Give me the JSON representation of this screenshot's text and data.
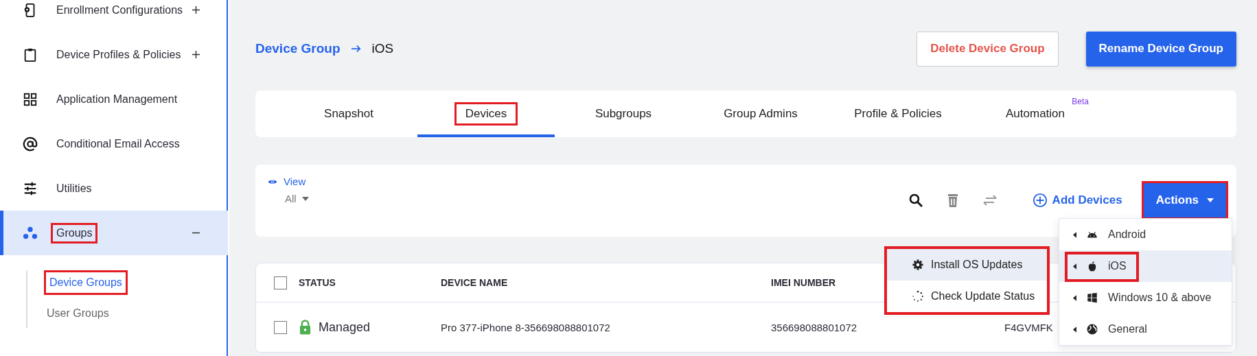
{
  "sidebar": {
    "items": [
      {
        "label": "Enrollment Configurations",
        "kind": "group",
        "expanded": false,
        "selected": false,
        "highlighted": false
      },
      {
        "label": "Device Profiles & Policies",
        "kind": "group",
        "expanded": false,
        "selected": false,
        "highlighted": false
      },
      {
        "label": "Application Management",
        "kind": "link",
        "selected": false,
        "highlighted": false
      },
      {
        "label": "Conditional Email Access",
        "kind": "link",
        "selected": false,
        "highlighted": false
      },
      {
        "label": "Utilities",
        "kind": "link",
        "selected": false,
        "highlighted": false
      },
      {
        "label": "Groups",
        "kind": "group",
        "expanded": true,
        "selected": true,
        "highlighted": true,
        "children": [
          {
            "label": "Device Groups",
            "selected": true,
            "highlighted": true
          },
          {
            "label": "User Groups",
            "selected": false,
            "highlighted": false
          }
        ]
      }
    ]
  },
  "breadcrumb": {
    "parent": "Device Group",
    "current": "iOS"
  },
  "header_buttons": {
    "delete": "Delete Device Group",
    "rename": "Rename Device Group"
  },
  "tabs": [
    {
      "label": "Snapshot",
      "selected": false,
      "highlighted": false
    },
    {
      "label": "Devices",
      "selected": true,
      "highlighted": true
    },
    {
      "label": "Subgroups",
      "selected": false,
      "highlighted": false
    },
    {
      "label": "Group Admins",
      "selected": false,
      "highlighted": false
    },
    {
      "label": "Profile & Policies",
      "selected": false,
      "highlighted": false
    },
    {
      "label": "Automation",
      "selected": false,
      "highlighted": false,
      "badge": "Beta"
    }
  ],
  "toolbar": {
    "view_label": "View",
    "view_filter": "All",
    "add_button": "Add Devices",
    "actions_button": {
      "label": "Actions",
      "highlighted": true
    }
  },
  "table": {
    "header_checked": false,
    "columns": [
      "STATUS",
      "DEVICE NAME",
      "IMEI NUMBER"
    ],
    "rows": [
      {
        "checked": false,
        "cells": [
          "Managed",
          "Pro 377-iPhone 8-356698088801072",
          "356698088801072",
          "F4GVMFK"
        ]
      }
    ]
  },
  "actions_menu": {
    "items": [
      {
        "label": "Android",
        "selected": false,
        "highlighted": false
      },
      {
        "label": "iOS",
        "selected": true,
        "highlighted": true
      },
      {
        "label": "Windows 10 & above",
        "selected": false,
        "highlighted": false
      },
      {
        "label": "General",
        "selected": false,
        "highlighted": false
      }
    ]
  },
  "submenu": {
    "highlighted": true,
    "items": [
      {
        "label": "Install OS Updates",
        "selected": true
      },
      {
        "label": "Check Update Status",
        "selected": false
      }
    ]
  }
}
